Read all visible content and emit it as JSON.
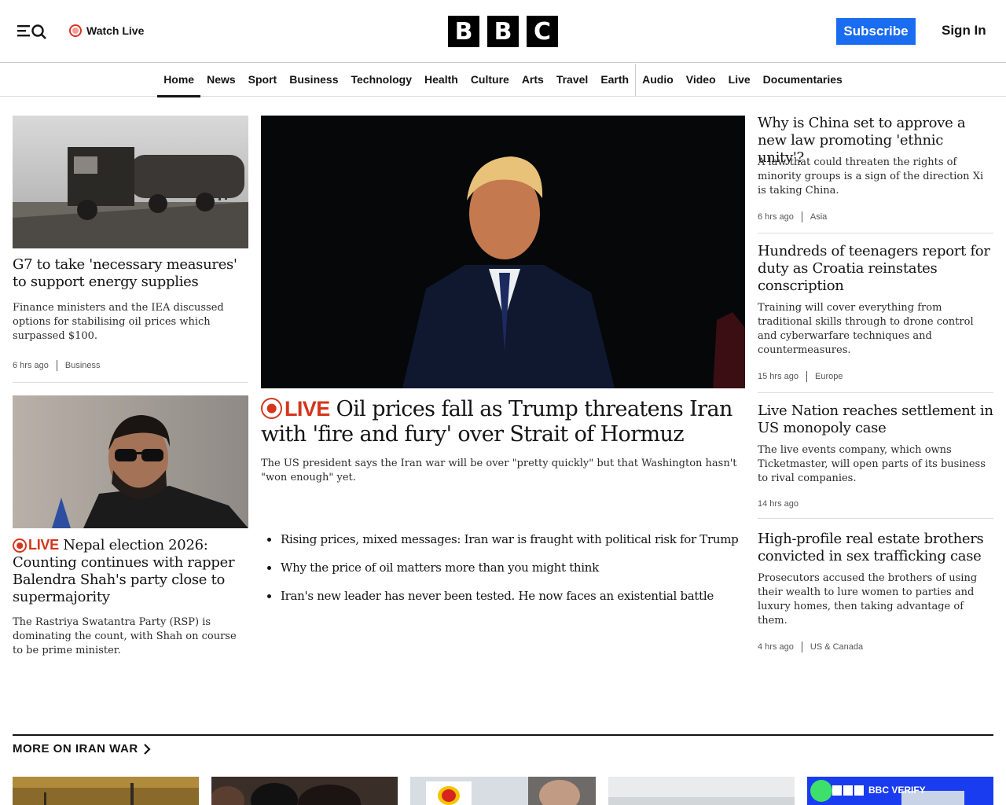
{
  "header": {
    "watch_live": "Watch Live",
    "logo_letters": [
      "B",
      "B",
      "C"
    ],
    "subscribe": "Subscribe",
    "sign_in": "Sign In"
  },
  "nav": {
    "items": [
      "Home",
      "News",
      "Sport",
      "Business",
      "Technology",
      "Health",
      "Culture",
      "Arts",
      "Travel",
      "Earth",
      "Audio",
      "Video",
      "Live",
      "Documentaries"
    ],
    "active": "Home"
  },
  "left": {
    "story1": {
      "title": "G7 to take 'necessary measures' to support energy supplies",
      "summary": "Finance ministers and the IEA discussed options for stabilising oil prices which surpassed $100.",
      "time": "6 hrs ago",
      "tag": "Business"
    },
    "story2": {
      "live_label": "LIVE",
      "title": "Nepal election 2026: Counting continues with rapper Balendra Shah's party close to supermajority",
      "summary": "The Rastriya Swatantra Party (RSP) is dominating the count, with Shah on course to be prime minister."
    }
  },
  "hero": {
    "live_label": "LIVE",
    "title": "Oil prices fall as Trump threatens Iran with 'fire and fury' over Strait of Hormuz",
    "summary": "The US president says the Iran war will be over \"pretty quickly\" but that Washington hasn't \"won enough\" yet.",
    "related": [
      "Rising prices, mixed messages: Iran war is fraught with political risk for Trump",
      "Why the price of oil matters more than you might think",
      "Iran's new leader has never been tested. He now faces an existential battle"
    ]
  },
  "right": [
    {
      "title": "Why is China set to approve a new law promoting 'ethnic unity'?",
      "summary": "A law that could threaten the rights of minority groups is a sign of the direction Xi is taking China.",
      "time": "6 hrs ago",
      "tag": "Asia"
    },
    {
      "title": "Hundreds of teenagers report for duty as Croatia reinstates conscription",
      "summary": "Training will cover everything from traditional skills through to drone control and cyberwarfare techniques and countermeasures.",
      "time": "15 hrs ago",
      "tag": "Europe"
    },
    {
      "title": "Live Nation reaches settlement in US monopoly case",
      "summary": "The live events company, which owns Ticketmaster, will open parts of its business to rival companies.",
      "time": "14 hrs ago",
      "tag": ""
    },
    {
      "title": "High-profile real estate brothers convicted in sex trafficking case",
      "summary": "Prosecutors accused the brothers of using their wealth to lure women to parties and luxury homes, then taking advantage of them.",
      "time": "4 hrs ago",
      "tag": "US & Canada"
    }
  ],
  "more_section": {
    "title": "MORE ON IRAN WAR",
    "verify_badge": "BBC VERIFY"
  },
  "colors": {
    "accent_blue": "#1a6cf0",
    "live_red": "#d4351c"
  }
}
